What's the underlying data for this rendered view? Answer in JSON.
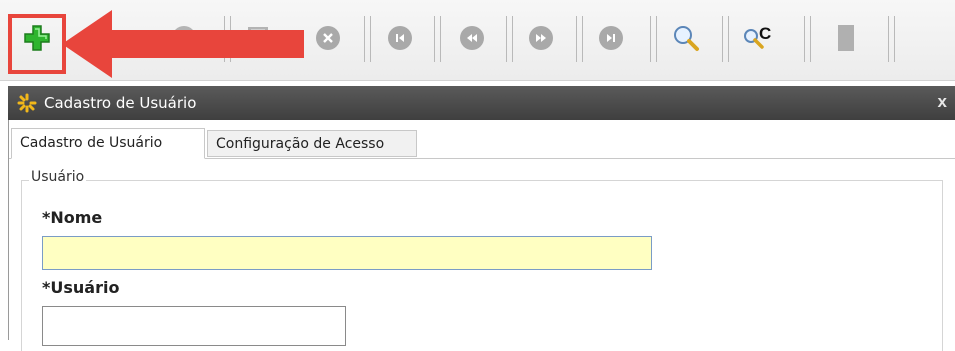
{
  "window": {
    "title": "Cadastro de Usuário",
    "close_glyph": "x"
  },
  "toolbar": {
    "buttons": [
      {
        "name": "add",
        "icon": "plus-icon"
      },
      {
        "name": "edit",
        "icon": "pencil-icon"
      },
      {
        "name": "save",
        "icon": "disk-icon"
      },
      {
        "name": "print",
        "icon": "printer-icon"
      },
      {
        "name": "delete",
        "icon": "delete-icon"
      },
      {
        "name": "first",
        "icon": "first-record-icon"
      },
      {
        "name": "previous",
        "icon": "previous-record-icon"
      },
      {
        "name": "next",
        "icon": "next-record-icon"
      },
      {
        "name": "last",
        "icon": "last-record-icon"
      },
      {
        "name": "search",
        "icon": "magnifier-icon"
      },
      {
        "name": "advanced-search",
        "icon": "search-code-icon"
      },
      {
        "name": "exit",
        "icon": "door-icon"
      }
    ],
    "search_code_glyph": "C",
    "highlight_color": "#e8453c"
  },
  "tabs": [
    {
      "label": "Cadastro de Usuário",
      "active": true
    },
    {
      "label": "Configuração de Acesso",
      "active": false
    }
  ],
  "form": {
    "group_label": "Usuário",
    "fields": {
      "nome": {
        "label": "*Nome",
        "value": ""
      },
      "usuario": {
        "label": "*Usuário",
        "value": ""
      }
    }
  },
  "colors": {
    "required_field_bg": "#ffffc2",
    "titlebar_bg": "#4a4a4a",
    "add_icon_green": "#2fb52f"
  }
}
